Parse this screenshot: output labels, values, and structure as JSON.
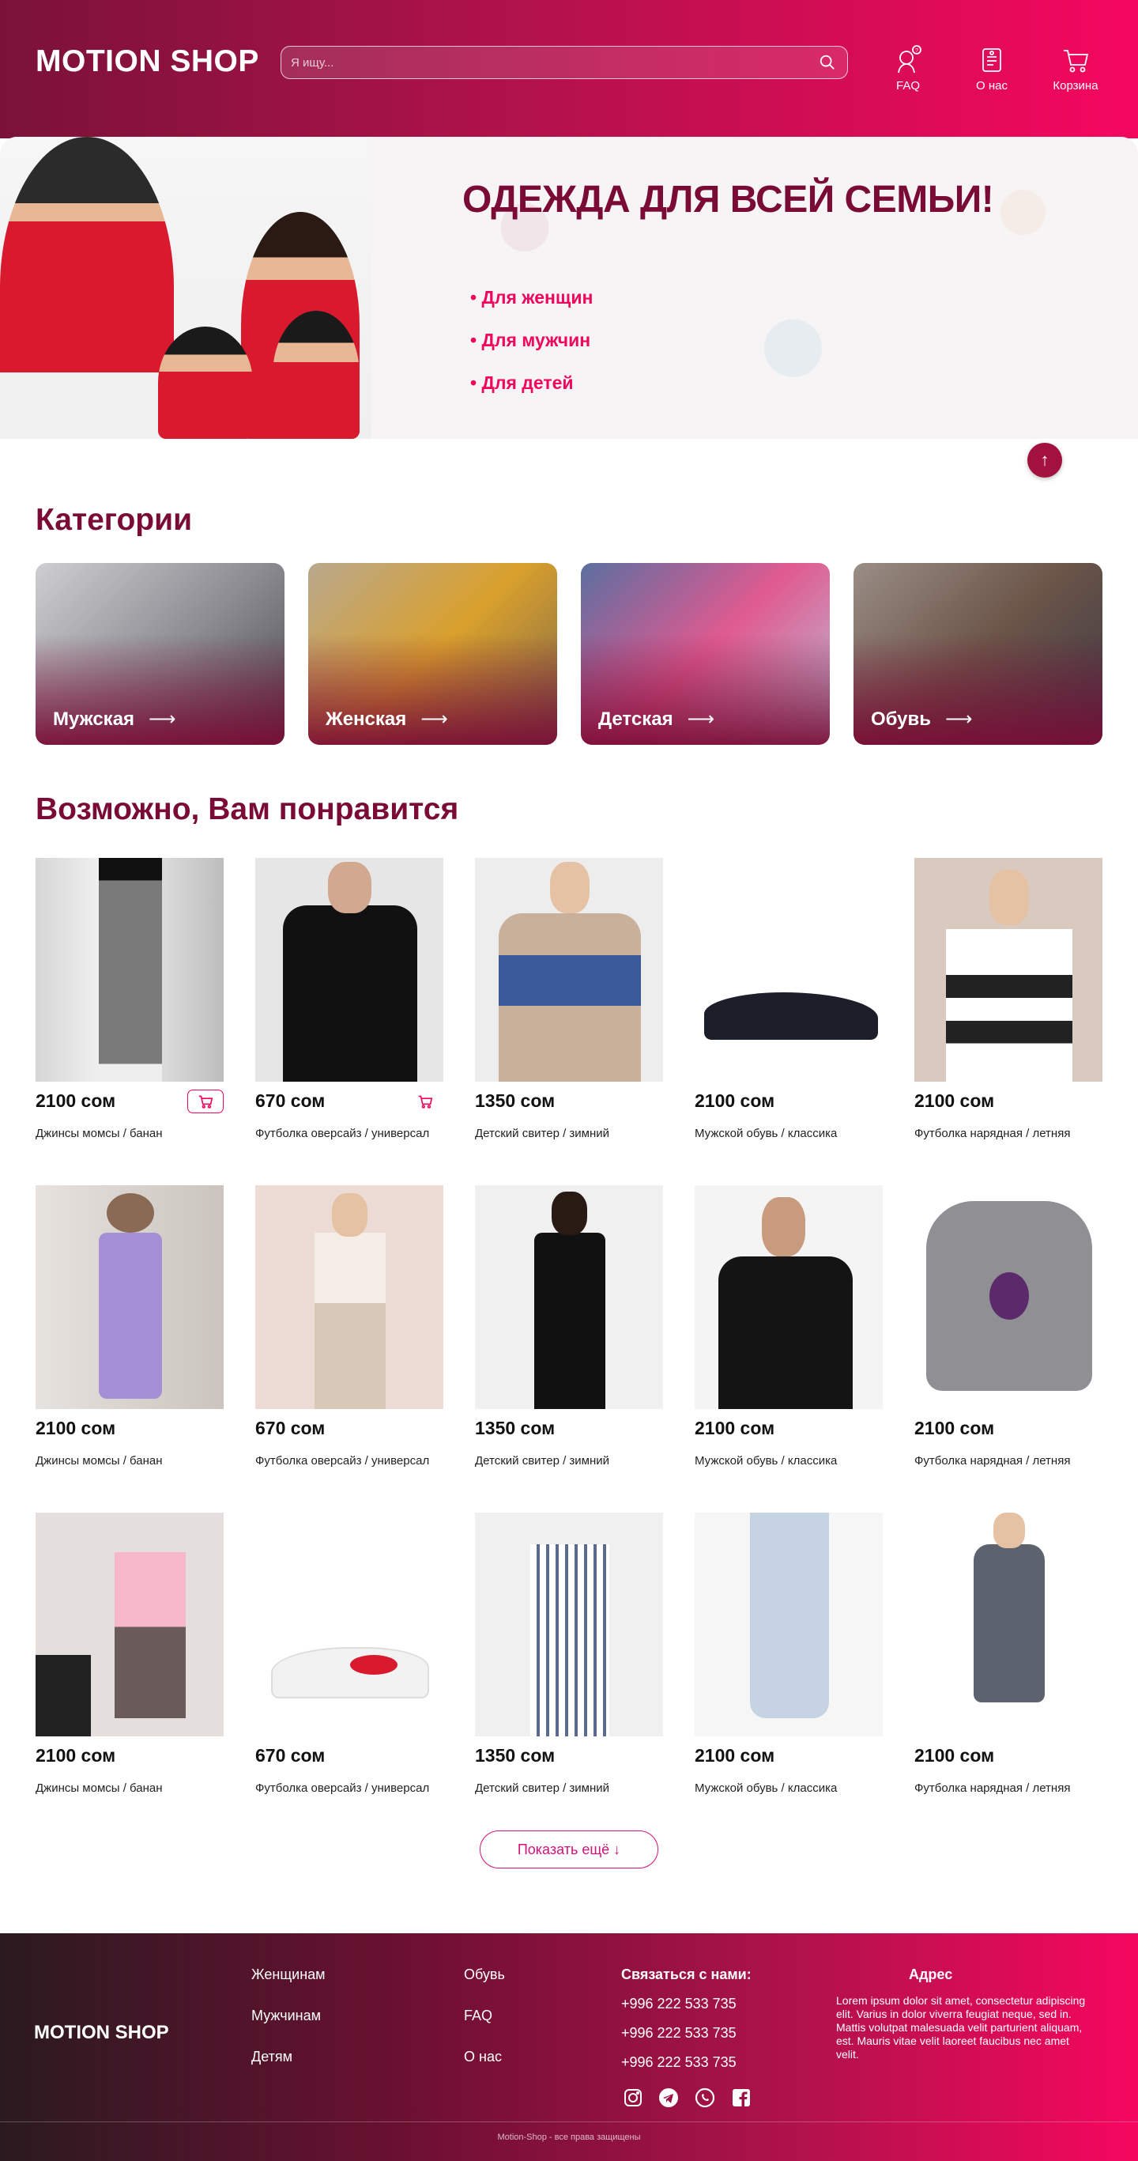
{
  "header": {
    "logo": "MOTION SHOP",
    "search_placeholder": "Я ищу...",
    "nav": {
      "faq": "FAQ",
      "about": "О нас",
      "cart": "Корзина"
    }
  },
  "hero": {
    "title": "ОДЕЖДА ДЛЯ ВСЕЙ СЕМЬИ!",
    "items": [
      "• Для женщин",
      "• Для мужчин",
      "• Для детей"
    ]
  },
  "categories": {
    "title": "Категории",
    "items": [
      {
        "label": "Мужская",
        "arrow": "⟶"
      },
      {
        "label": "Женская",
        "arrow": "⟶"
      },
      {
        "label": "Детская",
        "arrow": "⟶"
      },
      {
        "label": "Обувь",
        "arrow": "⟶"
      }
    ]
  },
  "recommend": {
    "title": "Возможно, Вам понравится",
    "rows": [
      [
        {
          "price": "2100 сом",
          "name": "Джинсы момсы / банан"
        },
        {
          "price": "670 сом",
          "name": "Футболка оверсайз / универсал"
        },
        {
          "price": "1350 сом",
          "name": "Детский свитер / зимний"
        },
        {
          "price": "2100 сом",
          "name": "Мужской обувь / классика"
        },
        {
          "price": "2100 сом",
          "name": "Футболка нарядная / летняя"
        }
      ],
      [
        {
          "price": "2100 сом",
          "name": "Джинсы момсы / банан"
        },
        {
          "price": "670 сом",
          "name": "Футболка оверсайз / универсал"
        },
        {
          "price": "1350 сом",
          "name": "Детский свитер / зимний"
        },
        {
          "price": "2100 сом",
          "name": "Мужской обувь / классика"
        },
        {
          "price": "2100 сом",
          "name": "Футболка нарядная / летняя"
        }
      ],
      [
        {
          "price": "2100 сом",
          "name": "Джинсы момсы / банан"
        },
        {
          "price": "670 сом",
          "name": "Футболка оверсайз / универсал"
        },
        {
          "price": "1350 сом",
          "name": "Детский свитер / зимний"
        },
        {
          "price": "2100 сом",
          "name": "Мужской обувь / классика"
        },
        {
          "price": "2100 сом",
          "name": "Футболка нарядная / летняя"
        }
      ]
    ],
    "show_more": "Показать ещё ↓"
  },
  "footer": {
    "logo": "MOTION SHOP",
    "links_col1": [
      "Женщинам",
      "Мужчинам",
      "Детям"
    ],
    "links_col2": [
      "Обувь",
      "FAQ",
      "О нас"
    ],
    "contact_title": "Связаться с нами:",
    "phones": [
      "+996 222 533 735",
      "+996 222 533 735",
      "+996 222 533 735"
    ],
    "address_title": "Адрес",
    "address_text": "Lorem ipsum dolor sit amet, consectetur adipiscing elit. Varius in dolor viverra feugiat neque, sed in. Mattis volutpat malesuada velit parturient aliquam, est. Mauris vitae velit laoreet faucibus nec amet velit.",
    "copyright": "Motion-Shop - все права защищены"
  },
  "colors": {
    "brand_dark": "#7a0b35",
    "brand_pink": "#f5075f",
    "accent": "#d4107a"
  },
  "icons": [
    "search-icon",
    "faq-icon",
    "about-icon",
    "cart-icon",
    "arrow-up-icon",
    "instagram-icon",
    "telegram-icon",
    "whatsapp-icon",
    "facebook-icon"
  ]
}
